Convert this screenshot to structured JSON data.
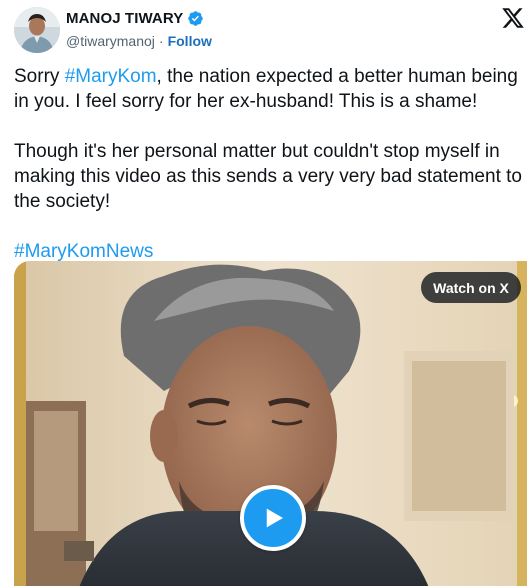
{
  "author": {
    "display_name": "MANOJ TIWARY",
    "handle": "@tiwarymanoj",
    "separator": "·",
    "follow_label": "Follow",
    "verified_icon": "verified-badge-icon",
    "avatar_icon": "avatar"
  },
  "platform": {
    "logo_icon": "x-logo-icon"
  },
  "tweet": {
    "p1_pre": "Sorry ",
    "p1_tag": "#MaryKom",
    "p1_post": ", the nation expected a better human being in you. I feel sorry for her ex-husband! This is a shame!",
    "p2": "Though it's her personal matter but couldn't stop myself in making this video as this sends a very very bad statement to the society!",
    "p3_tag": "#MaryKomNews"
  },
  "media": {
    "watch_label": "Watch on X",
    "play_icon": "play-icon"
  },
  "colors": {
    "link": "#1d9bf0",
    "follow": "#1d6fbd",
    "text": "#0f1419",
    "muted": "#536471",
    "play_button": "#1d9bf0"
  }
}
